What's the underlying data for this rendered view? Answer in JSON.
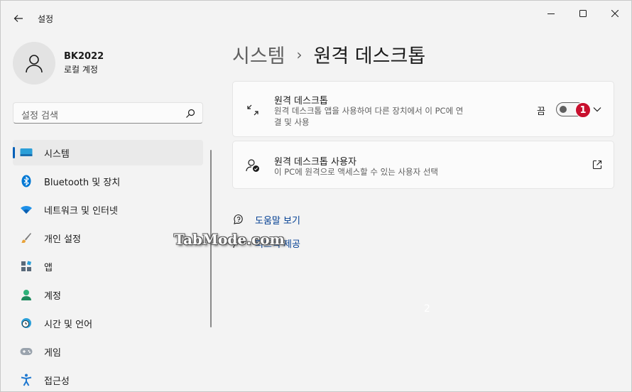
{
  "window": {
    "title": "설정"
  },
  "profile": {
    "name": "BK2022",
    "account_type": "로컬 계정"
  },
  "search": {
    "placeholder": "설정 검색"
  },
  "nav": {
    "items": [
      {
        "label": "시스템",
        "icon": "system-icon",
        "active": true
      },
      {
        "label": "Bluetooth 및 장치",
        "icon": "bluetooth-icon"
      },
      {
        "label": "네트워크 및 인터넷",
        "icon": "wifi-icon"
      },
      {
        "label": "개인 설정",
        "icon": "brush-icon"
      },
      {
        "label": "앱",
        "icon": "apps-icon"
      },
      {
        "label": "계정",
        "icon": "account-icon"
      },
      {
        "label": "시간 및 언어",
        "icon": "time-language-icon"
      },
      {
        "label": "게임",
        "icon": "gamepad-icon"
      },
      {
        "label": "접근성",
        "icon": "accessibility-icon"
      }
    ]
  },
  "breadcrumb": {
    "parent": "시스템",
    "separator": "›",
    "current": "원격 데스크톱"
  },
  "remote_desktop_card": {
    "title": "원격 데스크톱",
    "description": "원격 데스크톱 앱을 사용하여 다른 장치에서 이 PC에 연결 및 사용",
    "toggle_state_label": "끔",
    "toggle_on": false,
    "annotation_number": "1"
  },
  "remote_users_card": {
    "title": "원격 데스크톱 사용자",
    "description": "이 PC에 원격으로 액세스할 수 있는 사용자 선택"
  },
  "links": {
    "help": "도움말 보기",
    "feedback": "피드백 제공"
  },
  "overlay": {
    "watermark": "TabMode.com",
    "marker": "2"
  },
  "colors": {
    "accent": "#005fb8",
    "badge": "#c8102e",
    "link": "#003e92"
  }
}
